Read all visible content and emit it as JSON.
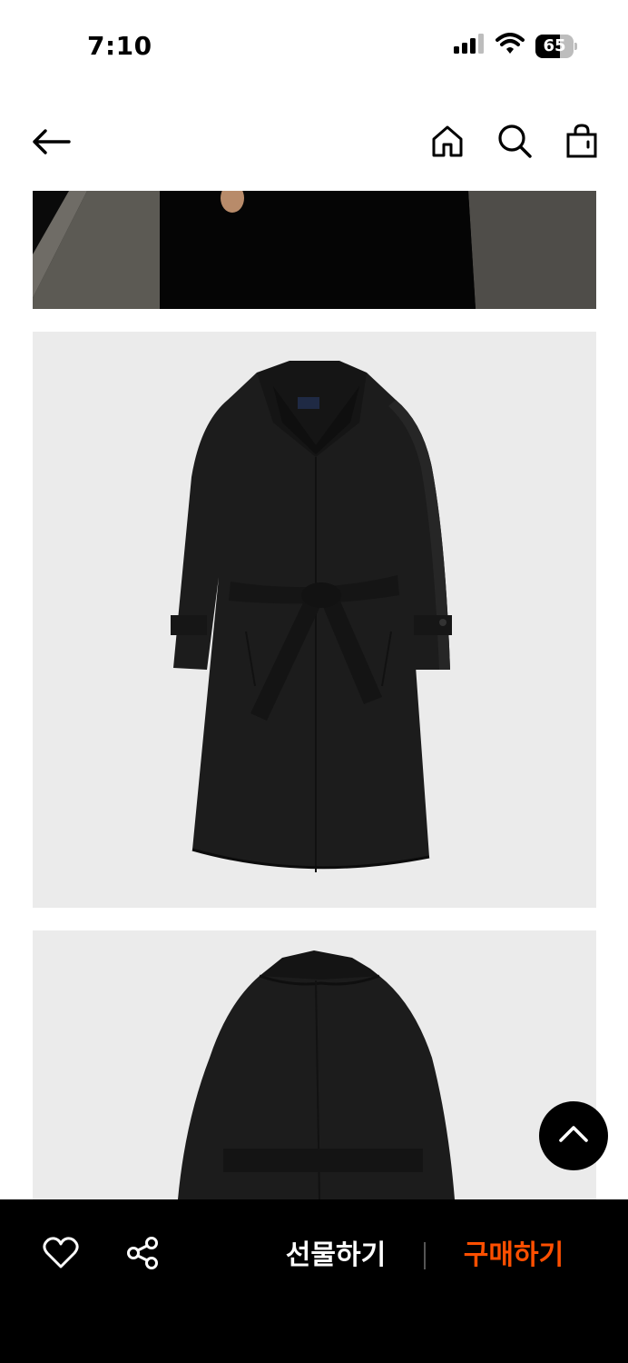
{
  "status_bar": {
    "time": "7:10",
    "battery_level": "65",
    "battery_fraction": 0.65,
    "icons": [
      "cellular-signal-icon",
      "wifi-icon",
      "battery-icon"
    ]
  },
  "nav": {
    "icons": [
      "back-arrow-icon",
      "home-icon",
      "search-icon",
      "shopping-bag-icon"
    ]
  },
  "product_images": [
    {
      "name": "model-wearing-coat",
      "view": "model"
    },
    {
      "name": "black-coat",
      "view": "front"
    },
    {
      "name": "black-coat",
      "view": "back"
    }
  ],
  "floating": {
    "icon": "chevron-up-icon"
  },
  "bottom_bar": {
    "gift_label": "선물하기",
    "buy_label": "구매하기",
    "buy_color": "#ff4f00",
    "icons": [
      "heart-icon",
      "share-icon"
    ]
  }
}
